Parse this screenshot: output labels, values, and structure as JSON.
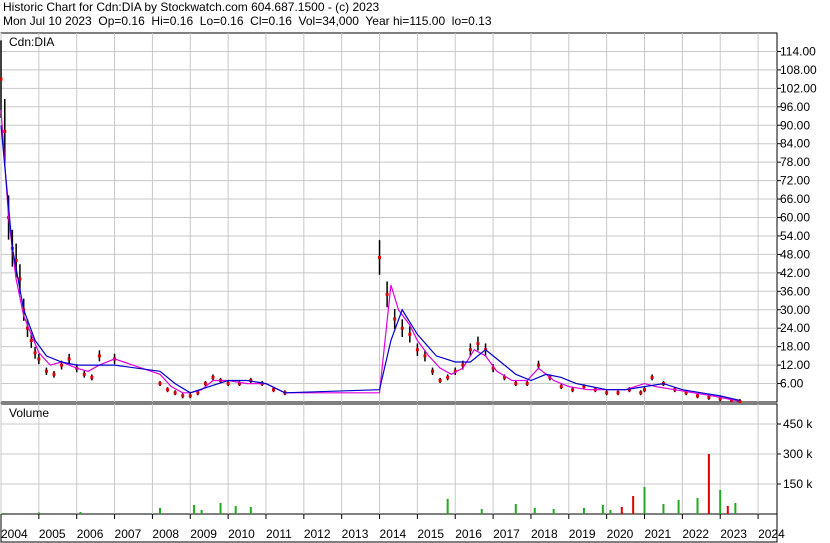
{
  "header": {
    "line1": "Historic Chart for Cdn:DIA by Stockwatch.com 604.687.1500 - (c) 2023",
    "line2": "Mon Jul 10 2023  Op=0.16  Hi=0.16  Lo=0.16  Cl=0.16  Vol=34,000  Year hi=115.00  lo=0.13"
  },
  "colors": {
    "background": "#ffffff",
    "grid": "#c8c8c8",
    "price_bars": "#000000",
    "close_markers": "#dd0000",
    "ma_short": "#dd00dd",
    "ma_long": "#0000cc",
    "volume_up": "#22aa22",
    "volume_down": "#dd0000"
  },
  "chart_data": [
    {
      "type": "line",
      "label": "Cdn:DIA",
      "ylim": [
        0,
        120
      ],
      "yticks": [
        6,
        12,
        18,
        24,
        30,
        36,
        42,
        48,
        54,
        60,
        66,
        72,
        78,
        84,
        90,
        96,
        102,
        108,
        114
      ],
      "ytick_labels": [
        "6.00",
        "12.00",
        "18.00",
        "24.00",
        "30.00",
        "36.00",
        "42.00",
        "48.00",
        "54.00",
        "60.00",
        "66.00",
        "72.00",
        "78.00",
        "84.00",
        "90.00",
        "96.00",
        "102.00",
        "108.00",
        "114.00"
      ],
      "xlim": [
        2004.0,
        2024.5
      ],
      "xticks": [
        2004,
        2005,
        2006,
        2007,
        2008,
        2009,
        2010,
        2011,
        2012,
        2013,
        2014,
        2015,
        2016,
        2017,
        2018,
        2019,
        2020,
        2021,
        2022,
        2023,
        2024
      ],
      "xtick_labels": [
        "2004",
        "2005",
        "2006",
        "2007",
        "2008",
        "2009",
        "2010",
        "2011",
        "2012",
        "2013",
        "2014",
        "2015",
        "2016",
        "2017",
        "2018",
        "2019",
        "2020",
        "2021",
        "2022",
        "2023",
        "2024"
      ],
      "grid": true,
      "series": [
        {
          "key": "close",
          "x": [
            2004.0,
            2004.1,
            2004.2,
            2004.3,
            2004.4,
            2004.5,
            2004.6,
            2004.7,
            2004.8,
            2004.9,
            2005.0,
            2005.2,
            2005.4,
            2005.6,
            2005.8,
            2006.0,
            2006.2,
            2006.4,
            2006.6,
            2007.0,
            2008.2,
            2008.4,
            2008.6,
            2008.8,
            2009.0,
            2009.2,
            2009.4,
            2009.6,
            2009.8,
            2010.0,
            2010.3,
            2010.6,
            2010.9,
            2011.2,
            2011.5,
            2014.0,
            2014.2,
            2014.4,
            2014.6,
            2014.8,
            2015.0,
            2015.2,
            2015.4,
            2015.6,
            2015.8,
            2016.0,
            2016.2,
            2016.4,
            2016.6,
            2016.8,
            2017.0,
            2017.3,
            2017.6,
            2017.9,
            2018.2,
            2018.5,
            2018.8,
            2019.1,
            2019.4,
            2019.7,
            2020.0,
            2020.3,
            2020.6,
            2020.9,
            2021.0,
            2021.2,
            2021.5,
            2021.8,
            2022.1,
            2022.4,
            2022.7,
            2023.0,
            2023.3,
            2023.52
          ],
          "values": [
            105,
            88,
            60,
            50,
            46,
            40,
            30,
            24,
            20,
            16,
            14,
            10,
            9,
            12,
            14,
            11,
            9,
            8,
            15,
            14,
            6,
            4,
            3,
            2,
            2,
            3,
            6,
            8,
            7,
            6,
            6,
            7,
            6,
            4,
            3,
            47,
            35,
            27,
            24,
            22,
            17,
            15,
            10,
            7,
            8,
            10,
            12,
            17,
            19,
            17,
            11,
            8,
            6,
            6,
            12,
            8,
            5,
            4,
            5,
            4,
            3,
            3,
            4,
            3,
            4,
            8,
            6,
            4,
            3,
            2,
            1.5,
            1.0,
            0.5,
            0.16
          ]
        },
        {
          "key": "ma_short",
          "x": [
            2004.0,
            2004.2,
            2004.4,
            2004.6,
            2004.8,
            2005.0,
            2005.3,
            2005.6,
            2006.0,
            2006.3,
            2006.6,
            2007.0,
            2008.2,
            2008.5,
            2008.8,
            2009.0,
            2009.3,
            2009.6,
            2010.0,
            2010.5,
            2011.0,
            2011.5,
            2014.0,
            2014.3,
            2014.5,
            2014.8,
            2015.0,
            2015.3,
            2015.6,
            2015.9,
            2016.2,
            2016.5,
            2016.8,
            2017.1,
            2017.5,
            2017.9,
            2018.2,
            2018.6,
            2019.0,
            2019.5,
            2020.0,
            2020.5,
            2021.0,
            2021.3,
            2021.8,
            2022.3,
            2022.8,
            2023.2,
            2023.52
          ],
          "values": [
            95,
            60,
            40,
            28,
            22,
            16,
            12,
            13,
            11,
            10,
            12,
            14,
            9,
            5,
            3,
            3,
            4,
            7,
            7,
            6,
            6,
            3,
            3,
            38,
            30,
            25,
            20,
            15,
            11,
            9,
            11,
            17,
            15,
            10,
            7,
            7,
            11,
            7,
            5,
            4,
            4,
            4,
            6,
            5,
            4,
            3,
            2,
            1,
            0.3
          ]
        },
        {
          "key": "ma_long",
          "x": [
            2004.0,
            2004.3,
            2004.6,
            2004.9,
            2005.2,
            2005.6,
            2006.0,
            2006.5,
            2007.0,
            2008.2,
            2008.6,
            2009.0,
            2009.5,
            2010.0,
            2010.5,
            2011.0,
            2011.5,
            2014.0,
            2014.3,
            2014.6,
            2015.0,
            2015.5,
            2016.0,
            2016.4,
            2016.8,
            2017.2,
            2017.6,
            2018.0,
            2018.4,
            2018.8,
            2019.2,
            2019.6,
            2020.0,
            2020.5,
            2021.0,
            2021.5,
            2022.0,
            2022.5,
            2023.0,
            2023.52
          ],
          "values": [
            90,
            50,
            30,
            20,
            15,
            13,
            12,
            12,
            12,
            10,
            6,
            3,
            5,
            7,
            7,
            6,
            3,
            4,
            20,
            30,
            22,
            15,
            13,
            13,
            17,
            13,
            9,
            7,
            9,
            8,
            6,
            5,
            4,
            4,
            5,
            6,
            4,
            3,
            2,
            0.5
          ]
        }
      ]
    },
    {
      "type": "bar",
      "label": "Volume",
      "ylim": [
        0,
        500000
      ],
      "yticks": [
        150000,
        300000,
        450000
      ],
      "ytick_labels": [
        "150 k",
        "300 k",
        "450 k"
      ],
      "series": [
        {
          "key": "volume",
          "x": [
            2004.1,
            2005.0,
            2006.1,
            2008.2,
            2009.1,
            2009.3,
            2009.8,
            2010.2,
            2010.6,
            2015.8,
            2016.7,
            2017.6,
            2018.1,
            2018.6,
            2019.4,
            2019.9,
            2020.1,
            2020.4,
            2020.7,
            2021.0,
            2021.5,
            2021.9,
            2022.4,
            2022.7,
            2023.0,
            2023.2,
            2023.4
          ],
          "values": [
            5000,
            8000,
            10000,
            30000,
            45000,
            20000,
            55000,
            40000,
            35000,
            75000,
            25000,
            50000,
            30000,
            25000,
            30000,
            45000,
            20000,
            35000,
            90000,
            135000,
            50000,
            70000,
            80000,
            300000,
            120000,
            40000,
            55000
          ],
          "direction": [
            "up",
            "up",
            "up",
            "up",
            "up",
            "up",
            "up",
            "up",
            "up",
            "up",
            "up",
            "up",
            "up",
            "up",
            "up",
            "up",
            "up",
            "down",
            "down",
            "up",
            "up",
            "up",
            "up",
            "down",
            "up",
            "down",
            "up"
          ]
        }
      ]
    }
  ]
}
